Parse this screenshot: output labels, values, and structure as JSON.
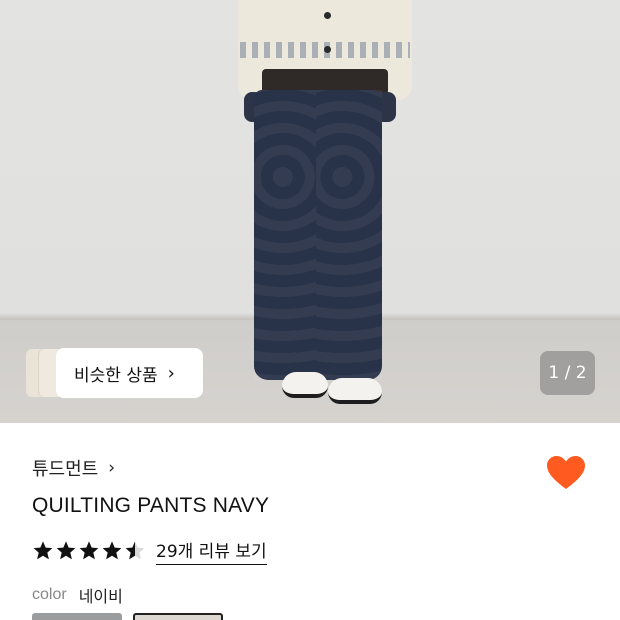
{
  "gallery": {
    "similar_label": "비슷한 상품",
    "similar_chevron": "›",
    "counter": "1 / 2"
  },
  "product": {
    "brand": "튜드먼트",
    "brand_chevron": "›",
    "name": "QUILTING PANTS NAVY",
    "rating_stars": 4.5,
    "review_link": "29개 리뷰 보기",
    "color_label": "color",
    "color_value": "네이비",
    "wishlisted": true
  },
  "colors": {
    "heart": "#ff5a1f",
    "star": "#111111"
  }
}
